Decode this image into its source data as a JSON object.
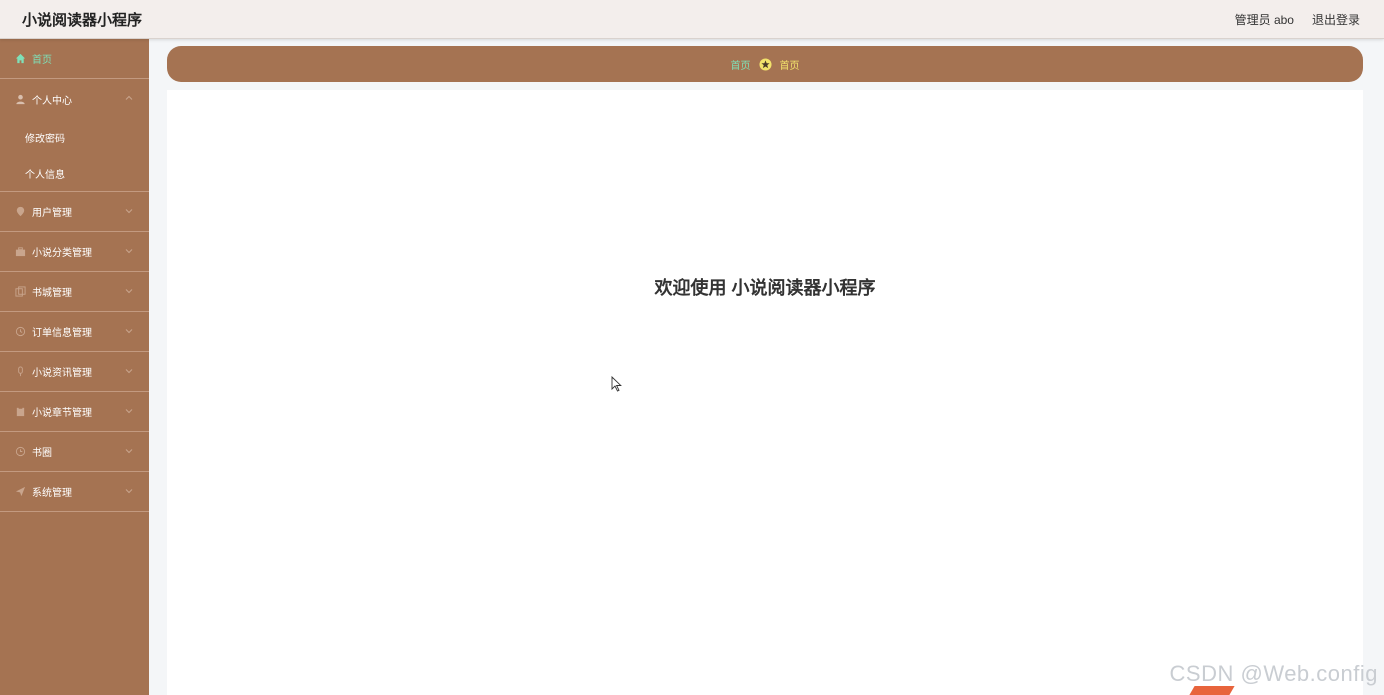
{
  "header": {
    "app_title": "小说阅读器小程序",
    "user_label": "管理员 abo",
    "logout_label": "退出登录"
  },
  "sidebar": {
    "items": [
      {
        "label": "首页",
        "icon": "home-icon",
        "active": true
      },
      {
        "label": "个人中心",
        "icon": "user-icon"
      },
      {
        "label": "用户管理",
        "icon": "location-icon"
      },
      {
        "label": "小说分类管理",
        "icon": "briefcase-icon"
      },
      {
        "label": "书城管理",
        "icon": "copy-icon"
      },
      {
        "label": "订单信息管理",
        "icon": "clock-icon"
      },
      {
        "label": "小说资讯管理",
        "icon": "microphone-icon"
      },
      {
        "label": "小说章节管理",
        "icon": "clipboard-icon"
      },
      {
        "label": "书圈",
        "icon": "time-icon"
      },
      {
        "label": "系统管理",
        "icon": "send-icon"
      }
    ],
    "sub_items": [
      {
        "label": "修改密码"
      },
      {
        "label": "个人信息"
      }
    ]
  },
  "breadcrumb": {
    "first": "首页",
    "second": "首页"
  },
  "main": {
    "welcome_text": "欢迎使用 小说阅读器小程序"
  },
  "watermark": "CSDN @Web.config",
  "colors": {
    "sidebar_bg": "#a57352",
    "active_text": "#7fe0b8",
    "crumb_highlight": "#f2e26b",
    "topbar_bg": "#f3eeec"
  }
}
